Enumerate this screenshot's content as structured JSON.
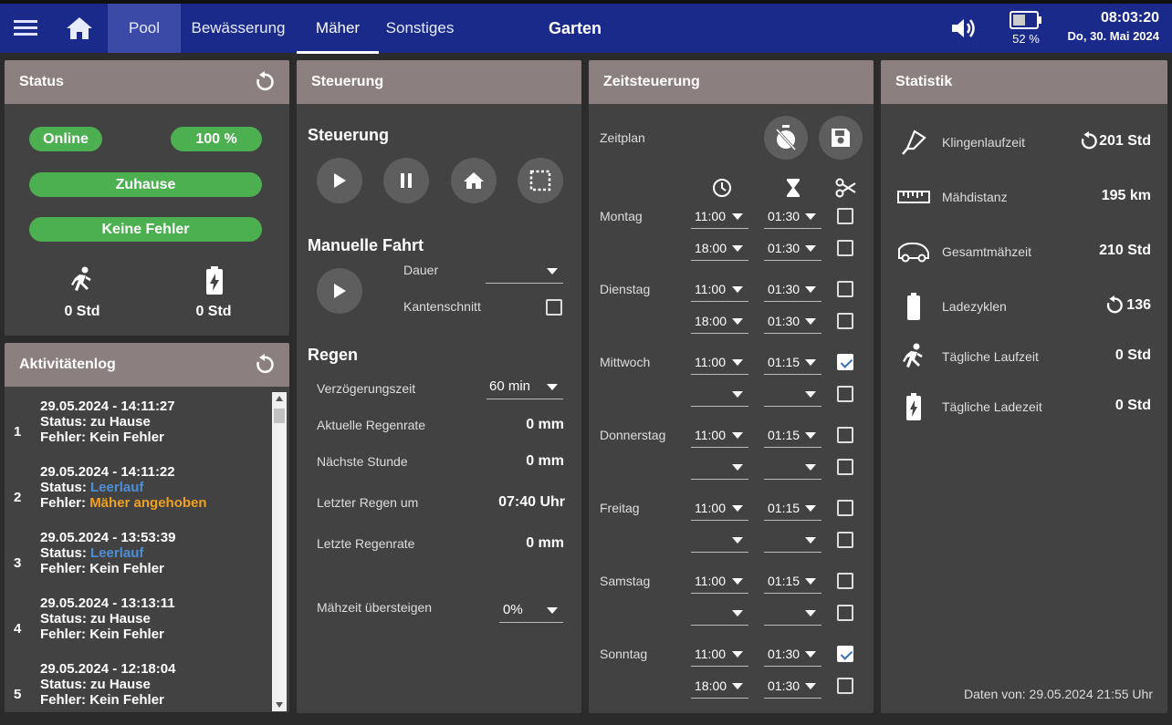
{
  "topbar": {
    "tabs": [
      "Pool",
      "Bewässerung",
      "Mäher",
      "Sonstiges"
    ],
    "title": "Garten",
    "battery": "52 %",
    "time": "08:03:20",
    "date": "Do, 30. Mai 2024"
  },
  "status": {
    "title": "Status",
    "online": "Online",
    "percent": "100 %",
    "location": "Zuhause",
    "errors": "Keine Fehler",
    "run_time": "0 Std",
    "charge_time": "0 Std"
  },
  "log": {
    "title": "Aktivitätenlog",
    "items": [
      {
        "n": "1",
        "date": "29.05.2024 - 14:11:27",
        "status_label": "Status:",
        "status": "zu Hause",
        "error_label": "Fehler:",
        "error": "Kein Fehler"
      },
      {
        "n": "2",
        "date": "29.05.2024 - 14:11:22",
        "status_label": "Status:",
        "status": "Leerlauf",
        "error_label": "Fehler:",
        "error": "Mäher angehoben"
      },
      {
        "n": "3",
        "date": "29.05.2024 - 13:53:39",
        "status_label": "Status:",
        "status": "Leerlauf",
        "error_label": "Fehler:",
        "error": "Kein Fehler"
      },
      {
        "n": "4",
        "date": "29.05.2024 - 13:13:11",
        "status_label": "Status:",
        "status": "zu Hause",
        "error_label": "Fehler:",
        "error": "Kein Fehler"
      },
      {
        "n": "5",
        "date": "29.05.2024 - 12:18:04",
        "status_label": "Status:",
        "status": "zu Hause",
        "error_label": "Fehler:",
        "error": "Kein Fehler"
      }
    ]
  },
  "control": {
    "title": "Steuerung",
    "section_control": "Steuerung",
    "section_manual": "Manuelle Fahrt",
    "duration_label": "Dauer",
    "edge_label": "Kantenschnitt",
    "section_rain": "Regen",
    "delay_label": "Verzögerungszeit",
    "delay_value": "60 min",
    "rain_rate_label": "Aktuelle Regenrate",
    "rain_rate": "0 mm",
    "next_hour_label": "Nächste Stunde",
    "next_hour": "0 mm",
    "last_rain_label": "Letzter Regen um",
    "last_rain": "07:40 Uhr",
    "last_rate_label": "Letzte Regenrate",
    "last_rate": "0 mm",
    "exceed_label": "Mähzeit übersteigen",
    "exceed_value": "0%"
  },
  "schedule": {
    "title": "Zeitsteuerung",
    "plan_label": "Zeitplan",
    "days": [
      {
        "name": "Montag",
        "rows": [
          {
            "start": "11:00",
            "dur": "01:30",
            "edge": false
          },
          {
            "start": "18:00",
            "dur": "01:30",
            "edge": false
          }
        ]
      },
      {
        "name": "Dienstag",
        "rows": [
          {
            "start": "11:00",
            "dur": "01:30",
            "edge": false
          },
          {
            "start": "18:00",
            "dur": "01:30",
            "edge": false
          }
        ]
      },
      {
        "name": "Mittwoch",
        "rows": [
          {
            "start": "11:00",
            "dur": "01:15",
            "edge": true
          },
          {
            "start": "",
            "dur": "",
            "edge": false
          }
        ]
      },
      {
        "name": "Donnerstag",
        "rows": [
          {
            "start": "11:00",
            "dur": "01:15",
            "edge": false
          },
          {
            "start": "",
            "dur": "",
            "edge": false
          }
        ]
      },
      {
        "name": "Freitag",
        "rows": [
          {
            "start": "11:00",
            "dur": "01:15",
            "edge": false
          },
          {
            "start": "",
            "dur": "",
            "edge": false
          }
        ]
      },
      {
        "name": "Samstag",
        "rows": [
          {
            "start": "11:00",
            "dur": "01:15",
            "edge": false
          },
          {
            "start": "",
            "dur": "",
            "edge": false
          }
        ]
      },
      {
        "name": "Sonntag",
        "rows": [
          {
            "start": "11:00",
            "dur": "01:30",
            "edge": true
          },
          {
            "start": "18:00",
            "dur": "01:30",
            "edge": false
          }
        ]
      }
    ]
  },
  "stats": {
    "title": "Statistik",
    "blade_label": "Klingenlaufzeit",
    "blade": "201 Std",
    "distance_label": "Mähdistanz",
    "distance": "195 km",
    "total_label": "Gesamtmähzeit",
    "total": "210 Std",
    "cycles_label": "Ladezyklen",
    "cycles": "136",
    "daily_run_label": "Tägliche Laufzeit",
    "daily_run": "0 Std",
    "daily_charge_label": "Tägliche Ladezeit",
    "daily_charge": "0 Std",
    "footer": "Daten von: 29.05.2024 21:55 Uhr"
  }
}
